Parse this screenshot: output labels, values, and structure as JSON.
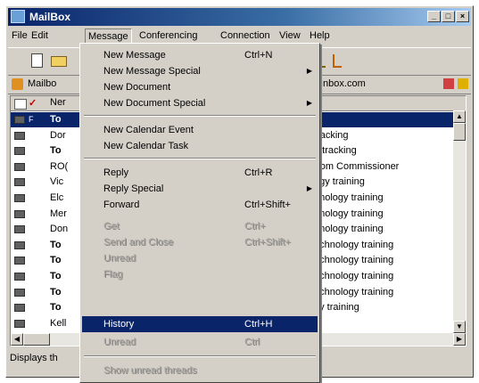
{
  "window": {
    "title": "MailBox",
    "controls": [
      "_",
      "□",
      "×"
    ]
  },
  "menubar": {
    "items": [
      {
        "label": "File"
      },
      {
        "label": "Edit"
      },
      {
        "label": "Message"
      },
      {
        "label": "Conferencing"
      },
      {
        "label": "Connection"
      },
      {
        "label": "View"
      },
      {
        "label": "Help"
      }
    ]
  },
  "addressbar": {
    "label": "Mailbo",
    "location": "Inbox.com"
  },
  "list": {
    "header": {
      "col1": "Ner"
    },
    "rows": [
      {
        "from": "To",
        "subject": "",
        "selected": true,
        "bold": true,
        "flag": "F"
      },
      {
        "from": "Dor",
        "subject": "tracking",
        "selected": false,
        "bold": false
      },
      {
        "from": "To",
        "subject": "d tracking",
        "selected": false,
        "bold": true
      },
      {
        "from": "RO(",
        "subject": "from Commissioner",
        "selected": false,
        "bold": false
      },
      {
        "from": "Vic",
        "subject": "ogy training",
        "selected": false,
        "bold": false
      },
      {
        "from": "Elc",
        "subject": "hnology training",
        "selected": false,
        "bold": false
      },
      {
        "from": "Mer",
        "subject": "hnology training",
        "selected": false,
        "bold": false
      },
      {
        "from": "Don",
        "subject": "hnology training",
        "selected": false,
        "bold": false
      },
      {
        "from": "To",
        "subject": "echnology training",
        "selected": false,
        "bold": true
      },
      {
        "from": "To",
        "subject": "echnology training",
        "selected": false,
        "bold": true
      },
      {
        "from": "To",
        "subject": "echnology training",
        "selected": false,
        "bold": true
      },
      {
        "from": "To",
        "subject": "echnology training",
        "selected": false,
        "bold": true
      },
      {
        "from": "To",
        "subject": "gy training",
        "selected": false,
        "bold": true
      },
      {
        "from": "Kell",
        "subject": "",
        "selected": false,
        "bold": false
      }
    ]
  },
  "status": {
    "text": "Displays th"
  },
  "menu": {
    "items": [
      {
        "label": "New Message",
        "shortcut": "Ctrl+N"
      },
      {
        "label": "New Message Special",
        "submenu": true
      },
      {
        "label": "New Document"
      },
      {
        "label": "New Document Special",
        "submenu": true
      },
      {
        "label": "New Calendar Event"
      },
      {
        "label": "New Calendar Task"
      },
      {
        "label": "Reply",
        "shortcut": "Ctrl+R"
      },
      {
        "label": "Reply Special",
        "submenu": true
      },
      {
        "label": "Forward",
        "shortcut": "Ctrl+Shift+"
      },
      {
        "label": "Get",
        "shortcut": "Ctrl+",
        "disabled": true
      },
      {
        "label": "Send and Close",
        "shortcut": "Ctrl+Shift+",
        "disabled": true
      },
      {
        "label": "Unread",
        "disabled": true
      },
      {
        "label": "Flag",
        "disabled": true
      },
      {
        "label": "History",
        "shortcut": "Ctrl+H",
        "highlighted": true
      },
      {
        "label": "Unread",
        "shortcut": "Ctrl",
        "disabled": true
      },
      {
        "label": "Show unread threads",
        "disabled": true
      }
    ]
  }
}
